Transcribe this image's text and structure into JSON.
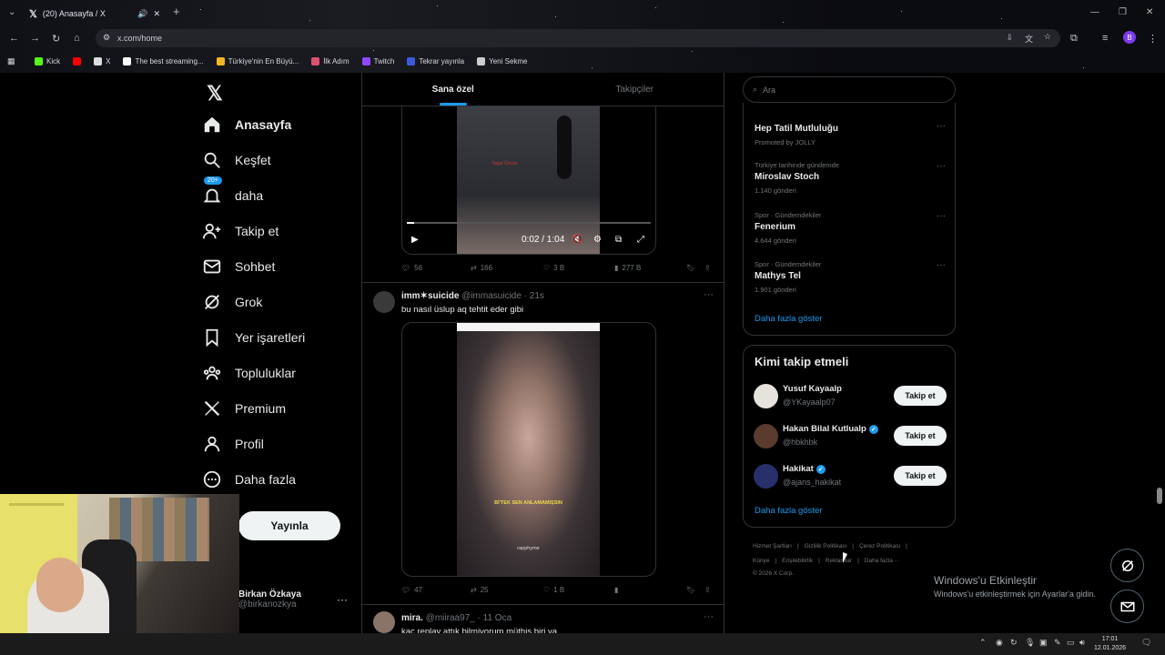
{
  "browser": {
    "tab_title": "(20) Anasayfa / X",
    "url": "x.com/home",
    "bookmarks": [
      {
        "label": "Kick",
        "color": "#53fc18"
      },
      {
        "label": "",
        "color": "#ff0000"
      },
      {
        "label": "X",
        "color": "#dddddd"
      },
      {
        "label": "The best streaming...",
        "color": "#ffffff"
      },
      {
        "label": "Türkiye'nin En Büyü...",
        "color": "#f5b623"
      },
      {
        "label": "İlk Adım",
        "color": "#e05070"
      },
      {
        "label": "Twitch",
        "color": "#9146ff"
      },
      {
        "label": "Tekrar yayınla",
        "color": "#3b5bdb"
      },
      {
        "label": "Yeni Sekme",
        "color": "#cccccc"
      }
    ],
    "profile_initial": "B"
  },
  "nav": {
    "items": [
      {
        "label": "Anasayfa",
        "icon": "home-icon"
      },
      {
        "label": "Keşfet",
        "icon": "search-icon"
      },
      {
        "label": "daha",
        "icon": "bell-icon",
        "badge": "20+"
      },
      {
        "label": "Takip et",
        "icon": "follow-icon"
      },
      {
        "label": "Sohbet",
        "icon": "mail-icon"
      },
      {
        "label": "Grok",
        "icon": "grok-icon"
      },
      {
        "label": "Yer işaretleri",
        "icon": "bookmark-icon"
      },
      {
        "label": "Topluluklar",
        "icon": "communities-icon"
      },
      {
        "label": "Premium",
        "icon": "x-icon"
      },
      {
        "label": "Profil",
        "icon": "profile-icon"
      },
      {
        "label": "Daha fazla",
        "icon": "more-icon"
      }
    ],
    "post_button": "Yayınla",
    "account": {
      "name": "Birkan Özkaya",
      "handle": "@birkanozkya"
    }
  },
  "timeline": {
    "tabs": [
      "Sana özel",
      "Takipçiler"
    ],
    "post1": {
      "video_time": "0:02 / 1:04",
      "video_caption": "Yaşar Özcan",
      "replies": "56",
      "reposts": "166",
      "likes": "3 B",
      "views": "277 B"
    },
    "post2": {
      "name": "imm✶suicide",
      "handle": "@immasuicide",
      "time": "· 21s",
      "text": "bu nasıl üslup aq tehtit eder gibi",
      "caption": "Bİ'TEK SEN ANLAMAMIŞSIN",
      "watermark": "rapphyme",
      "replies": "47",
      "reposts": "25",
      "likes": "1 B"
    },
    "post3": {
      "name": "mira.",
      "handle": "@miiraa97_",
      "time": "· 11 Oca",
      "text": "kaç replay attık bilmiyorum müthiş biri ya"
    }
  },
  "right": {
    "search_placeholder": "Ara",
    "trends": [
      {
        "category": "",
        "title": "Hep Tatil Mutluluğu",
        "count": "Promoted by JOLLY"
      },
      {
        "category": "Türkiye tarihinde gündemde",
        "title": "Miroslav Stoch",
        "count": "1.140 gönderi"
      },
      {
        "category": "Spor · Gündemdekiler",
        "title": "Fenerium",
        "count": "4.644 gönderi"
      },
      {
        "category": "Spor · Gündemdekiler",
        "title": "Mathys Tel",
        "count": "1.901 gönderi"
      }
    ],
    "show_more": "Daha fazla göster",
    "who_to_follow_title": "Kimi takip etmeli",
    "follow": [
      {
        "name": "Yusuf Kayaalp",
        "handle": "@YKayaalp07",
        "verified": false
      },
      {
        "name": "Hakan Bilal Kutlualp",
        "handle": "@hbkhbk",
        "verified": true
      },
      {
        "name": "Hakikat",
        "handle": "@ajans_hakikat",
        "verified": true
      }
    ],
    "follow_button": "Takip et",
    "footer_row1": [
      "Hizmet Şartları",
      "|",
      "Gizlilik Politikası",
      "|",
      "Çerez Politikası",
      "|"
    ],
    "footer_row2": [
      "Künye",
      "|",
      "Erişilebilirlik",
      "|",
      "Reklamlar",
      "|",
      "Daha fazla ···"
    ],
    "copyright": "© 2026 X Corp."
  },
  "windows": {
    "activate_title": "Windows'u Etkinleştir",
    "activate_sub": "Windows'u etkinleştirmek için Ayarlar'a gidin.",
    "time": "17:01",
    "date": "12.01.2026"
  }
}
